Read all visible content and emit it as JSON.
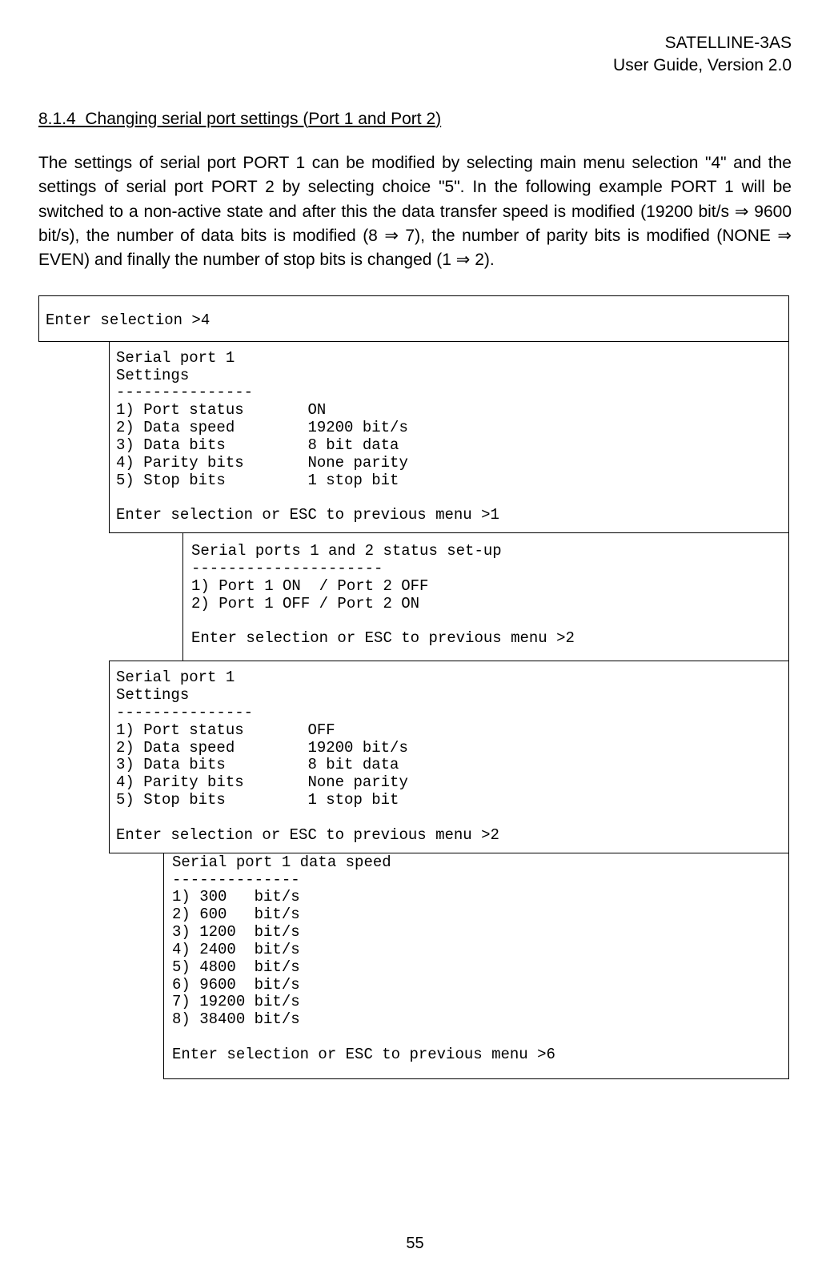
{
  "header": {
    "line1": "SATELLINE-3AS",
    "line2": "User Guide, Version 2.0"
  },
  "section": {
    "number": "8.1.4",
    "title_prefix": "Changing serial port settings (",
    "port1": "Port 1",
    "mid": " and ",
    "port2": "Port 2",
    "title_suffix": ")"
  },
  "paragraph": "The settings of serial port PORT 1 can be modified by selecting main menu selection \"4\" and the settings of serial port PORT 2 by selecting choice \"5\". In the following example PORT 1 will be switched to a non-active state and after this the data transfer speed is modified (19200 bit/s ⇒ 9600 bit/s), the number of data bits is modified  (8 ⇒ 7), the number of parity bits is modified (NONE ⇒ EVEN) and finally the number of stop bits is changed (1 ⇒ 2).",
  "box0": "Enter selection >4",
  "box1": "Serial port 1\nSettings\n---------------\n1) Port status       ON\n2) Data speed        19200 bit/s\n3) Data bits         8 bit data\n4) Parity bits       None parity\n5) Stop bits         1 stop bit\n\nEnter selection or ESC to previous menu >1",
  "box2": "Serial ports 1 and 2 status set-up\n---------------------\n1) Port 1 ON  / Port 2 OFF\n2) Port 1 OFF / Port 2 ON\n\nEnter selection or ESC to previous menu >2",
  "box3": "Serial port 1\nSettings\n---------------\n1) Port status       OFF\n2) Data speed        19200 bit/s\n3) Data bits         8 bit data\n4) Parity bits       None parity\n5) Stop bits         1 stop bit\n\nEnter selection or ESC to previous menu >2",
  "box4": "Serial port 1 data speed\n--------------\n1) 300   bit/s\n2) 600   bit/s\n3) 1200  bit/s\n4) 2400  bit/s\n5) 4800  bit/s\n6) 9600  bit/s\n7) 19200 bit/s\n8) 38400 bit/s\n\nEnter selection or ESC to previous menu >6",
  "page_number": "55"
}
